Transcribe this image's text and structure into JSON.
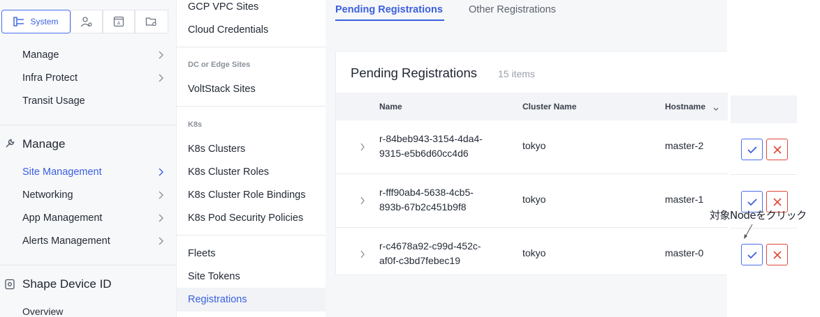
{
  "left_nav": {
    "tabs": [
      {
        "label": "System",
        "icon": "hierarchy-icon",
        "active": true
      },
      {
        "label": "",
        "icon": "user-settings-icon"
      },
      {
        "label": "",
        "icon": "browser-a-icon"
      },
      {
        "label": "",
        "icon": "folder-gear-icon"
      }
    ],
    "items_top": [
      {
        "label": "Manage",
        "chevron": true
      },
      {
        "label": "Infra Protect",
        "chevron": true
      },
      {
        "label": "Transit Usage",
        "chevron": false
      }
    ],
    "manage_section": {
      "title": "Manage",
      "icon": "wrench-icon",
      "items": [
        {
          "label": "Site Management",
          "chevron": true,
          "active": true
        },
        {
          "label": "Networking",
          "chevron": true
        },
        {
          "label": "App Management",
          "chevron": true
        },
        {
          "label": "Alerts Management",
          "chevron": true
        }
      ]
    },
    "shape_section": {
      "title": "Shape Device ID",
      "icon": "device-id-icon",
      "items": [
        {
          "label": "Overview"
        }
      ]
    }
  },
  "submenu": {
    "top_items": [
      "GCP VPC Sites",
      "Cloud Credentials"
    ],
    "groups": [
      {
        "heading": "DC or Edge Sites",
        "items": [
          "VoltStack Sites"
        ]
      },
      {
        "heading": "K8s",
        "items": [
          "K8s Clusters",
          "K8s Cluster Roles",
          "K8s Cluster Role Bindings",
          "K8s Pod Security Policies"
        ]
      },
      {
        "heading": "",
        "items": [
          "Fleets",
          "Site Tokens",
          "Registrations"
        ]
      }
    ],
    "selected": "Registrations"
  },
  "main": {
    "tabs": [
      {
        "label": "Pending Registrations",
        "active": true
      },
      {
        "label": "Other Registrations",
        "active": false
      }
    ],
    "card": {
      "title": "Pending Registrations",
      "count": "15 items",
      "columns": [
        "Name",
        "Cluster Name",
        "Hostname"
      ],
      "rows": [
        {
          "name_line1": "r-84beb943-3154-4da4-",
          "name_line2": "9315-e5b6d60cc4d6",
          "cluster": "tokyo",
          "hostname": "master-2"
        },
        {
          "name_line1": "r-fff90ab4-5638-4cb5-",
          "name_line2": "893b-67b2c451b9f8",
          "cluster": "tokyo",
          "hostname": "master-1"
        },
        {
          "name_line1": "r-c4678a92-c99d-452c-",
          "name_line2": "af0f-c3bd7febec19",
          "cluster": "tokyo",
          "hostname": "master-0"
        }
      ]
    }
  },
  "annotation": {
    "text": "対象Nodeをクリック"
  },
  "colors": {
    "accent": "#3b5fe0",
    "reject": "#e0463a",
    "muted": "#9aa0aa"
  }
}
